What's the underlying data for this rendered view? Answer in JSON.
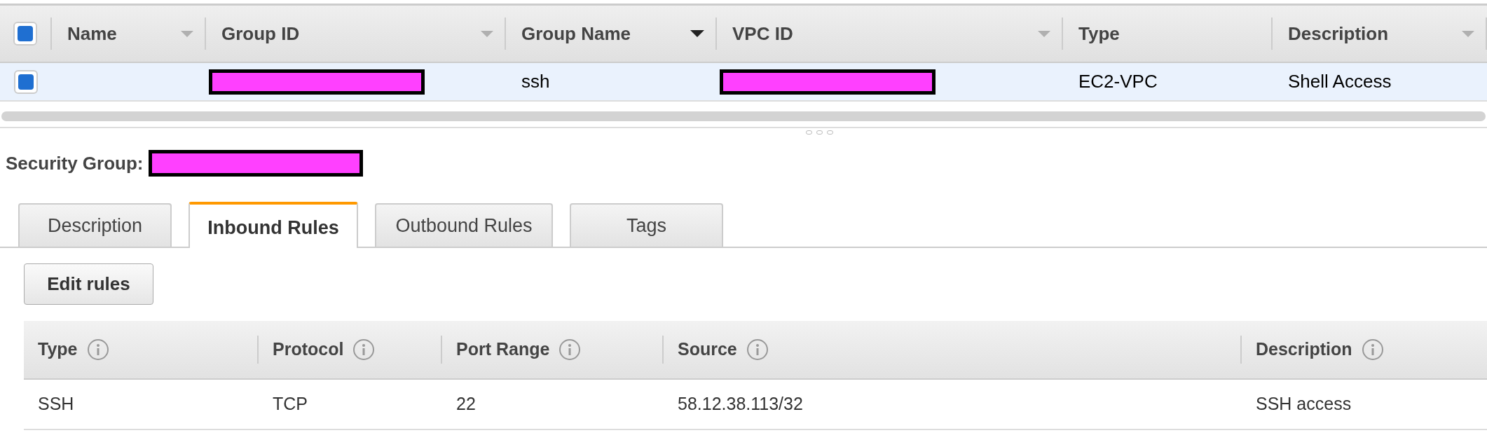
{
  "groups_table": {
    "select_all": {
      "checked": true
    },
    "columns": [
      {
        "label": "Name",
        "kind": "sortable",
        "sorted": false
      },
      {
        "label": "Group ID",
        "kind": "sortable",
        "sorted": false
      },
      {
        "label": "Group Name",
        "kind": "sortable",
        "sorted": true
      },
      {
        "label": "VPC ID",
        "kind": "sortable",
        "sorted": false
      },
      {
        "label": "Type",
        "kind": "plain"
      },
      {
        "label": "Description",
        "kind": "sortable",
        "sorted": false
      }
    ],
    "rows": [
      {
        "selected": true,
        "cells": [
          {
            "kind": "empty"
          },
          {
            "kind": "redacted"
          },
          {
            "kind": "text",
            "text": "ssh"
          },
          {
            "kind": "redacted"
          },
          {
            "kind": "text",
            "text": "EC2-VPC"
          },
          {
            "kind": "text",
            "text": "Shell Access"
          }
        ]
      }
    ]
  },
  "details": {
    "label": "Security Group:",
    "value_redacted": true
  },
  "tabs": [
    {
      "label": "Description",
      "selected": false
    },
    {
      "label": "Inbound Rules",
      "selected": true
    },
    {
      "label": "Outbound Rules",
      "selected": false
    },
    {
      "label": "Tags",
      "selected": false
    }
  ],
  "edit_button": "Edit rules",
  "rules_table": {
    "columns": [
      {
        "label": "Type",
        "info": true
      },
      {
        "label": "Protocol",
        "info": true
      },
      {
        "label": "Port Range",
        "info": true
      },
      {
        "label": "Source",
        "info": true
      },
      {
        "label": "Description",
        "info": true
      }
    ],
    "rows": [
      [
        "SSH",
        "TCP",
        "22",
        "58.12.38.113/32",
        "SSH access"
      ]
    ]
  }
}
